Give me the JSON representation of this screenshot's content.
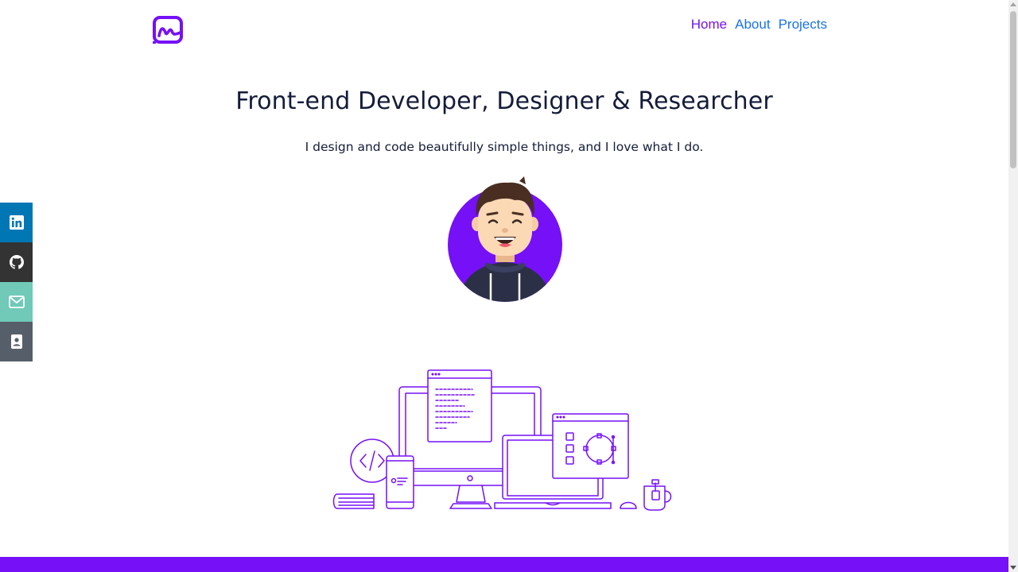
{
  "brand": {
    "logo_icon": "logo-m-icon",
    "color": "#7510f7"
  },
  "nav": {
    "items": [
      {
        "label": "Home",
        "color": "#7510f7"
      },
      {
        "label": "About",
        "color": "#1a73e8"
      },
      {
        "label": "Projects",
        "color": "#1a73e8"
      }
    ]
  },
  "hero": {
    "headline": "Front-end Developer, Designer & Researcher",
    "tagline": "I design and code beautifully simple things, and I love what I do.",
    "avatar_icon": "avatar-illustration"
  },
  "social": [
    {
      "icon": "linkedin-icon",
      "color": "#0077b5"
    },
    {
      "icon": "github-icon",
      "color": "#333333"
    },
    {
      "icon": "mail-icon",
      "color": "#71c9b8"
    },
    {
      "icon": "contact-card-icon",
      "color": "#565f69"
    }
  ],
  "illustration_icon": "devices-illustration",
  "colors": {
    "accent": "#7510f7",
    "text": "#141c3a"
  }
}
